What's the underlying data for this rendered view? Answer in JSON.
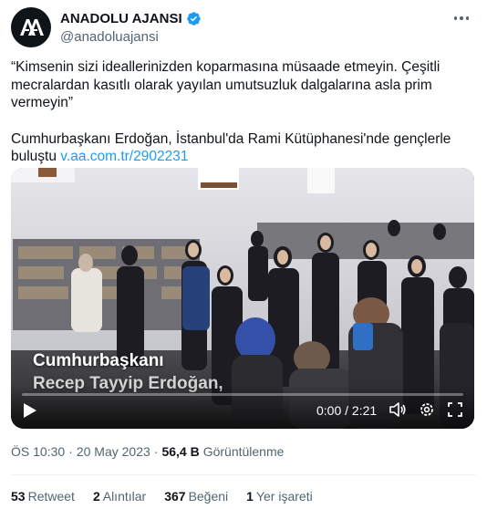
{
  "account": {
    "display_name": "ANADOLU AJANSI",
    "handle": "@anadoluajansi",
    "verified": true,
    "verified_color": "#1d9bf0"
  },
  "tweet": {
    "paragraph1": "“Kimsenin sizi ideallerinizden koparmasına müsaade etmeyin. Çeşitli mecralardan kasıtlı olarak yayılan umutsuzluk dalgalarına asla prim vermeyin”",
    "paragraph2_text": "Cumhurbaşkanı Erdoğan, İstanbul'da Rami Kütüphanesi'nde gençlerle buluştu ",
    "paragraph2_link": "v.aa.com.tr/2902231"
  },
  "video": {
    "caption_line1": "Cumhurbaşkanı",
    "caption_line2": "Recep Tayyip Erdoğan,",
    "time": "0:00 / 2:21",
    "progress_fraction": 0.0
  },
  "meta": {
    "time": "ÖS 10:30",
    "separator": "·",
    "date": "20 May 2023",
    "views_count": "56,4 B",
    "views_label": "Görüntülenme"
  },
  "stats": {
    "retweets_count": "53",
    "retweets_label": "Retweet",
    "quotes_count": "2",
    "quotes_label": "Alıntılar",
    "likes_count": "367",
    "likes_label": "Beğeni",
    "bookmarks_count": "1",
    "bookmarks_label": "Yer işareti"
  },
  "colors": {
    "text": "#0f1419",
    "secondary": "#536471",
    "link": "#1d9bf0",
    "divider": "#eff3f4"
  },
  "icons": [
    "aa-logo-icon",
    "verified-badge-icon",
    "more-options-icon",
    "play-icon",
    "volume-icon",
    "settings-icon",
    "fullscreen-icon"
  ]
}
